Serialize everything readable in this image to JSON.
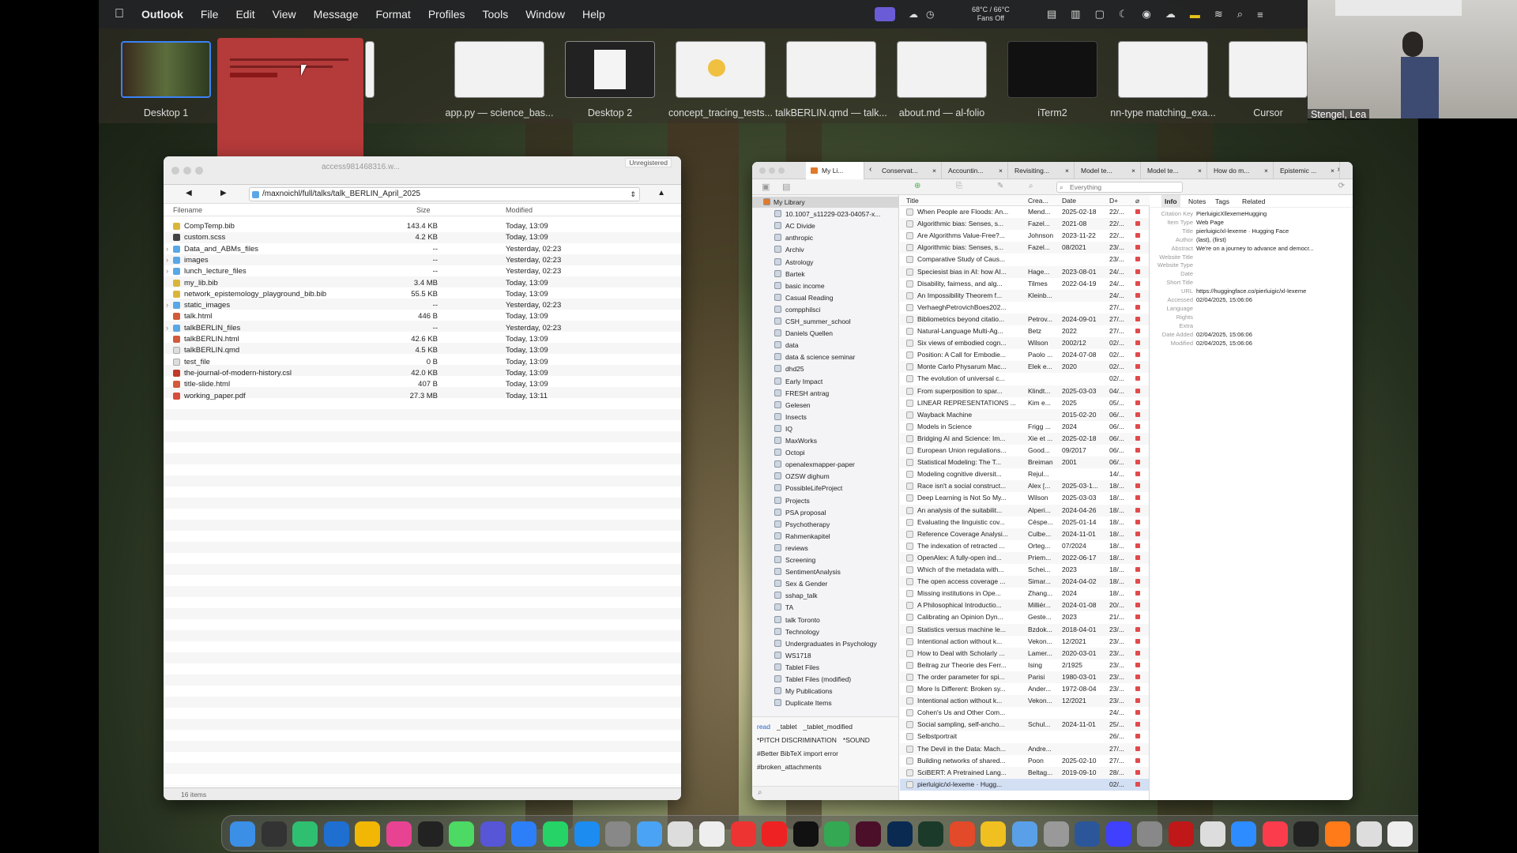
{
  "menubar": {
    "app": "Outlook",
    "items": [
      "File",
      "Edit",
      "View",
      "Message",
      "Format",
      "Profiles",
      "Tools",
      "Window",
      "Help"
    ],
    "temp": "68°C / 66°C",
    "fans": "Fans Off"
  },
  "spaces": [
    {
      "label": "Desktop 1"
    },
    {
      "label": ""
    },
    {
      "label": "app.py — science_bas..."
    },
    {
      "label": "Desktop 2"
    },
    {
      "label": "concept_tracing_tests..."
    },
    {
      "label": "talkBERLIN.qmd — talk..."
    },
    {
      "label": "about.md — al-folio"
    },
    {
      "label": "iTerm2"
    },
    {
      "label": "nn-type matching_exa..."
    },
    {
      "label": "Cursor"
    }
  ],
  "participant_name": "Stengel, Lea",
  "filebrowser": {
    "title": "access981468316.w...",
    "unregistered": "Unregistered",
    "path": "/maxnoichl/full/talks/talk_BERLIN_April_2025",
    "col_filename": "Filename",
    "col_size": "Size",
    "col_modified": "Modified",
    "status": "16 items",
    "files": [
      {
        "name": "CompTemp.bib",
        "size": "143.4 KB",
        "modified": "Today, 13:09",
        "type": "bib"
      },
      {
        "name": "custom.scss",
        "size": "4.2 KB",
        "modified": "Today, 13:09",
        "type": "scss"
      },
      {
        "name": "Data_and_ABMs_files",
        "size": "--",
        "modified": "Yesterday, 02:23",
        "type": "folder"
      },
      {
        "name": "images",
        "size": "--",
        "modified": "Yesterday, 02:23",
        "type": "folder"
      },
      {
        "name": "lunch_lecture_files",
        "size": "--",
        "modified": "Yesterday, 02:23",
        "type": "folder"
      },
      {
        "name": "my_lib.bib",
        "size": "3.4 MB",
        "modified": "Today, 13:09",
        "type": "bib"
      },
      {
        "name": "network_epistemology_playground_bib.bib",
        "size": "55.5 KB",
        "modified": "Today, 13:09",
        "type": "bib"
      },
      {
        "name": "static_images",
        "size": "--",
        "modified": "Yesterday, 02:23",
        "type": "folder"
      },
      {
        "name": "talk.html",
        "size": "446 B",
        "modified": "Today, 13:09",
        "type": "html"
      },
      {
        "name": "talkBERLIN_files",
        "size": "--",
        "modified": "Yesterday, 02:23",
        "type": "folder"
      },
      {
        "name": "talkBERLIN.html",
        "size": "42.6 KB",
        "modified": "Today, 13:09",
        "type": "html"
      },
      {
        "name": "talkBERLIN.qmd",
        "size": "4.5 KB",
        "modified": "Today, 13:09",
        "type": "file"
      },
      {
        "name": "test_file",
        "size": "0 B",
        "modified": "Today, 13:09",
        "type": "file"
      },
      {
        "name": "the-journal-of-modern-history.csl",
        "size": "42.0 KB",
        "modified": "Today, 13:09",
        "type": "csl"
      },
      {
        "name": "title-slide.html",
        "size": "407 B",
        "modified": "Today, 13:09",
        "type": "html"
      },
      {
        "name": "working_paper.pdf",
        "size": "27.3 MB",
        "modified": "Today, 13:11",
        "type": "pdf"
      }
    ]
  },
  "zotero": {
    "tabs": [
      "My Li...",
      "Conservat...",
      "Accountin...",
      "Revisiting...",
      "Model te...",
      "Model te...",
      "How do m...",
      "Epistemic ..."
    ],
    "search_placeholder": "Everything",
    "collections": [
      "My Library",
      "10.1007_s11229-023-04057-x...",
      "AC Divide",
      "anthropic",
      "Archiv",
      "Astrology",
      "Bartek",
      "basic income",
      "Casual Reading",
      "compphilsci",
      "CSH_summer_school",
      "Daniels Quellen",
      "data",
      "data & science seminar",
      "dhd25",
      "Early Impact",
      "FRESH antrag",
      "Gelesen",
      "Insects",
      "IQ",
      "MaxWorks",
      "Octopi",
      "openalexmapper-paper",
      "OZSW dighum",
      "PossibleLifeProject",
      "Projects",
      "PSA proposal",
      "Psychotherapy",
      "Rahmenkapitel",
      "reviews",
      "Screening",
      "SentimentAnalysis",
      "Sex & Gender",
      "sshap_talk",
      "TA",
      "talk Toronto",
      "Technology",
      "Undergraduates in Psychology",
      "WS1718",
      "Tablet Files",
      "Tablet Files (modified)",
      "My Publications",
      "Duplicate Items"
    ],
    "tags": [
      "read",
      "_tablet",
      "_tablet_modified",
      "*PITCH DISCRIMINATION",
      "*SOUND",
      "#Better BibTeX import error",
      "#broken_attachments"
    ],
    "col_title": "Title",
    "col_creator": "Crea...",
    "col_date": "Date",
    "col_da": "D+",
    "items": [
      [
        "When People are Floods: An...",
        "Mend...",
        "2025-02-18",
        "22/..."
      ],
      [
        "Algorithmic bias: Senses, s...",
        "Fazel...",
        "2021-08",
        "22/..."
      ],
      [
        "Are Algorithms Value-Free?...",
        "Johnson",
        "2023-11-22",
        "22/..."
      ],
      [
        "Algorithmic bias: Senses, s...",
        "Fazel...",
        "08/2021",
        "23/..."
      ],
      [
        "Comparative Study of Caus...",
        "",
        "",
        "23/..."
      ],
      [
        "Speciesist bias in AI: how AI...",
        "Hage...",
        "2023-08-01",
        "24/..."
      ],
      [
        "Disability, fairness, and alg...",
        "Tilmes",
        "2022-04-19",
        "24/..."
      ],
      [
        "An Impossibility Theorem f...",
        "Kleinb...",
        "",
        "24/..."
      ],
      [
        "VerhaeghPetrovichBoes202...",
        "",
        "",
        "27/..."
      ],
      [
        "Bibliometrics beyond citatio...",
        "Petrov...",
        "2024-09-01",
        "27/..."
      ],
      [
        "Natural-Language Multi-Ag...",
        "Betz",
        "2022",
        "27/..."
      ],
      [
        "Six views of embodied cogn...",
        "Wilson",
        "2002/12",
        "02/..."
      ],
      [
        "Position: A Call for Embodie...",
        "Paolo ...",
        "2024-07-08",
        "02/..."
      ],
      [
        "Monte Carlo Physarum Mac...",
        "Elek e...",
        "2020",
        "02/..."
      ],
      [
        "The evolution of universal c...",
        "",
        "",
        "02/..."
      ],
      [
        "From superposition to spar...",
        "Klindt...",
        "2025-03-03",
        "04/..."
      ],
      [
        "LINEAR REPRESENTATIONS ...",
        "Kim e...",
        "2025",
        "05/..."
      ],
      [
        "Wayback Machine",
        "",
        "2015-02-20",
        "06/..."
      ],
      [
        "Models in Science",
        "Frigg ...",
        "2024",
        "06/..."
      ],
      [
        "Bridging AI and Science: Im...",
        "Xie et ...",
        "2025-02-18",
        "06/..."
      ],
      [
        "European Union regulations...",
        "Good...",
        "09/2017",
        "06/..."
      ],
      [
        "Statistical Modeling: The T...",
        "Breiman",
        "2001",
        "06/..."
      ],
      [
        "Modeling cognitive diversit...",
        "Rejul...",
        "",
        "14/..."
      ],
      [
        "Race isn't a social construct...",
        "Alex [...",
        "2025-03-1...",
        "18/..."
      ],
      [
        "Deep Learning is Not So My...",
        "Wilson",
        "2025-03-03",
        "18/..."
      ],
      [
        "An analysis of the suitabilit...",
        "Alperi...",
        "2024-04-26",
        "18/..."
      ],
      [
        "Evaluating the linguistic cov...",
        "Céspe...",
        "2025-01-14",
        "18/..."
      ],
      [
        "Reference Coverage Analysi...",
        "Culbe...",
        "2024-11-01",
        "18/..."
      ],
      [
        "The indexation of retracted ...",
        "Orteg...",
        "07/2024",
        "18/..."
      ],
      [
        "OpenAlex: A fully-open ind...",
        "Priem...",
        "2022-06-17",
        "18/..."
      ],
      [
        "Which of the metadata with...",
        "Schei...",
        "2023",
        "18/..."
      ],
      [
        "The open access coverage ...",
        "Simar...",
        "2024-04-02",
        "18/..."
      ],
      [
        "Missing institutions in Ope...",
        "Zhang...",
        "2024",
        "18/..."
      ],
      [
        "A Philosophical Introductio...",
        "Milliér...",
        "2024-01-08",
        "20/..."
      ],
      [
        "Calibrating an Opinion Dyn...",
        "Geste...",
        "2023",
        "21/..."
      ],
      [
        "Statistics versus machine le...",
        "Bzdok...",
        "2018-04-01",
        "23/..."
      ],
      [
        "Intentional action without k...",
        "Vekon...",
        "12/2021",
        "23/..."
      ],
      [
        "How to Deal with Scholarly ...",
        "Lamer...",
        "2020-03-01",
        "23/..."
      ],
      [
        "Beitrag zur Theorie des Ferr...",
        "Ising",
        "2/1925",
        "23/..."
      ],
      [
        "The order parameter for spi...",
        "Parisi",
        "1980-03-01",
        "23/..."
      ],
      [
        "More Is Different: Broken sy...",
        "Ander...",
        "1972-08-04",
        "23/..."
      ],
      [
        "Intentional action without k...",
        "Vekon...",
        "12/2021",
        "23/..."
      ],
      [
        "Cohen's Us and Other Com...",
        "",
        "",
        "24/..."
      ],
      [
        "Social sampling, self-ancho...",
        "Schul...",
        "2024-11-01",
        "25/..."
      ],
      [
        "Selbstportrait",
        "",
        "",
        "26/..."
      ],
      [
        "The Devil in the Data: Mach...",
        "Andre...",
        "",
        "27/..."
      ],
      [
        "Building networks of shared...",
        "Poon",
        "2025-02-10",
        "27/..."
      ],
      [
        "SciBERT: A Pretrained Lang...",
        "Beltag...",
        "2019-09-10",
        "28/..."
      ],
      [
        "pierluigic/xl-lexeme · Hugg...",
        "",
        "",
        "02/..."
      ]
    ],
    "info_tabs": [
      "Info",
      "Notes",
      "Tags",
      "Related"
    ],
    "info": [
      [
        "Citation Key",
        "PierluigicXllexemeHugging"
      ],
      [
        "Item Type",
        "Web Page"
      ],
      [
        "Title",
        "pierluigic/xl-lexeme · Hugging Face"
      ],
      [
        "Author",
        "(last), (first)"
      ],
      [
        "Abstract",
        "We're on a journey to advance and democr..."
      ],
      [
        "Website Title",
        ""
      ],
      [
        "Website Type",
        ""
      ],
      [
        "Date",
        ""
      ],
      [
        "Short Title",
        ""
      ],
      [
        "URL",
        "https://huggingface.co/pierluigic/xl-lexeme"
      ],
      [
        "Accessed",
        "02/04/2025, 15:06:06"
      ],
      [
        "Language",
        ""
      ],
      [
        "Rights",
        ""
      ],
      [
        "Extra",
        ""
      ],
      [
        "Date Added",
        "02/04/2025, 15:06:06"
      ],
      [
        "Modified",
        "02/04/2025, 15:06:06"
      ]
    ]
  }
}
